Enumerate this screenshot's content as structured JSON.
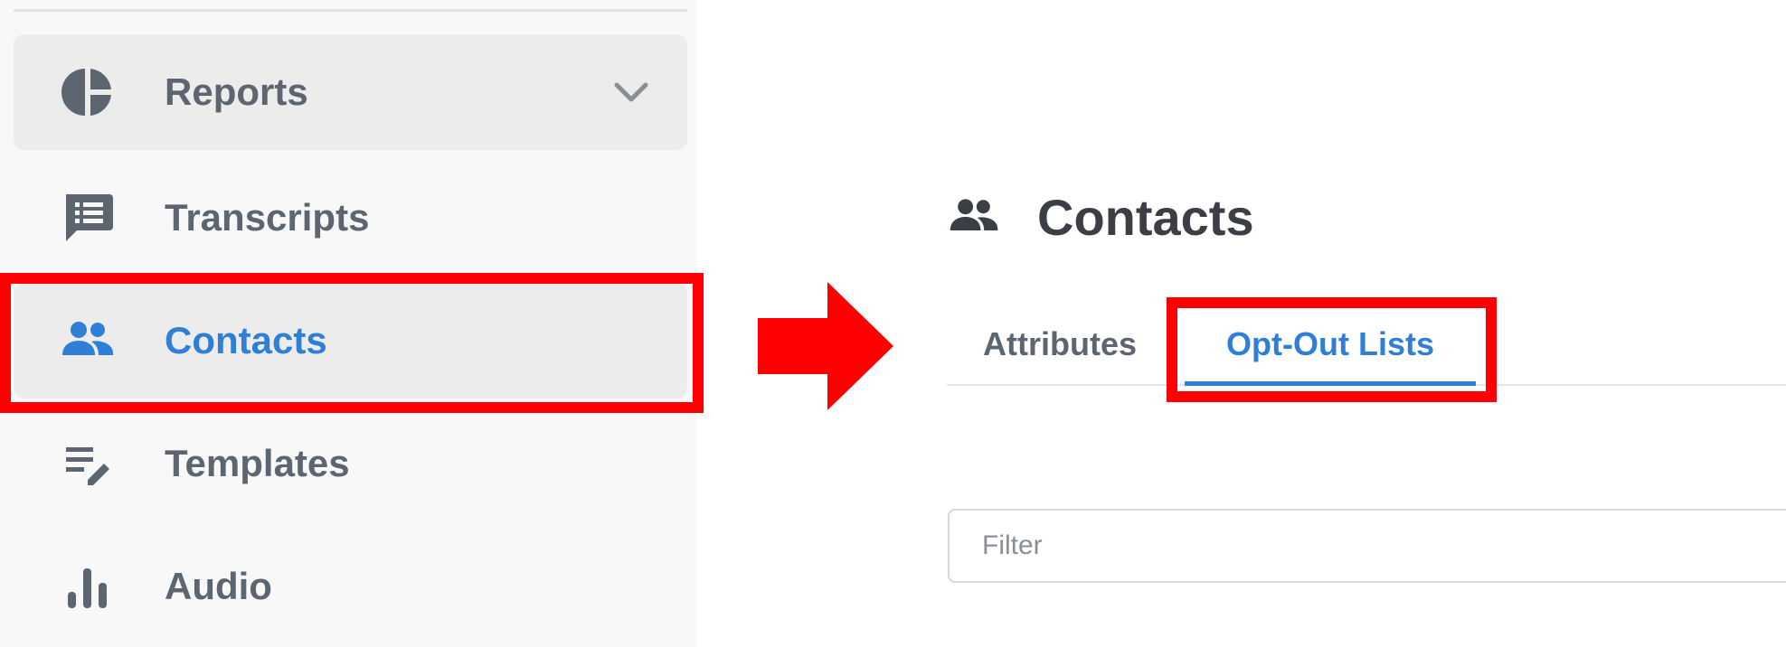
{
  "sidebar": {
    "items": [
      {
        "label": "Reports",
        "icon": "pie-chart-icon",
        "expandable": true
      },
      {
        "label": "Transcripts",
        "icon": "chat-list-icon"
      },
      {
        "label": "Contacts",
        "icon": "people-icon",
        "active": true
      },
      {
        "label": "Templates",
        "icon": "edit-list-icon"
      },
      {
        "label": "Audio",
        "icon": "bar-chart-icon"
      }
    ]
  },
  "main": {
    "title": "Contacts",
    "title_icon": "people-icon",
    "tabs": [
      {
        "label": "Attributes"
      },
      {
        "label": "Opt-Out Lists",
        "active": true
      }
    ],
    "filter": {
      "placeholder": "Filter",
      "value": ""
    }
  },
  "colors": {
    "accent": "#2f7fd6",
    "highlight": "#ff0000",
    "text": "#5d6670",
    "sidebar_bg": "#f8f8f8"
  }
}
